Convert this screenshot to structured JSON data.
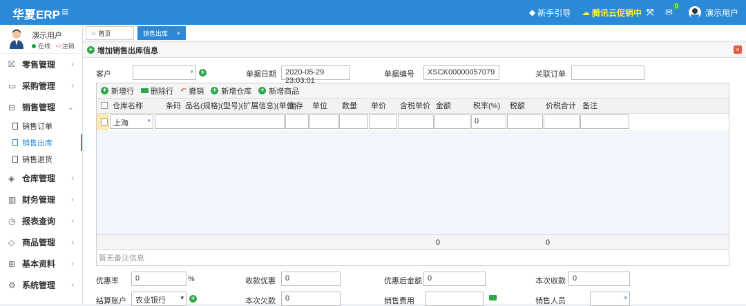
{
  "app": {
    "logo": "华夏ERP",
    "hamburger": "≡"
  },
  "topbar": {
    "guide": "新手引导",
    "promo": "腾讯云促销中",
    "mail_badge": "0",
    "user": "演示用户"
  },
  "user": {
    "name": "演示用户",
    "online": "在线",
    "logout": "注销"
  },
  "menu": [
    {
      "label": "零售管理",
      "icon": "gift-icon"
    },
    {
      "label": "采购管理",
      "icon": "monitor-icon"
    },
    {
      "label": "销售管理",
      "icon": "briefcase-icon"
    },
    {
      "label": "仓库管理",
      "icon": "layers-icon"
    },
    {
      "label": "财务管理",
      "icon": "columns-icon"
    },
    {
      "label": "报表查询",
      "icon": "clock-icon"
    },
    {
      "label": "商品管理",
      "icon": "gem-icon"
    },
    {
      "label": "基本资料",
      "icon": "grid-icon"
    },
    {
      "label": "系统管理",
      "icon": "gear-icon"
    }
  ],
  "submenu": [
    "销售订单",
    "销售出库",
    "销售退货"
  ],
  "tabs": {
    "home": "首页",
    "current": "销售出库",
    "close": "×"
  },
  "panel": {
    "title": "增加销售出库信息"
  },
  "form": {
    "customer_label": "客户",
    "date_label": "单据日期",
    "date_value": "2020-05-29 23:03:01",
    "number_label": "单据编号",
    "number_value": "XSCK00000057079",
    "order_label": "关联订单"
  },
  "toolbar": {
    "add_row": "新增行",
    "del_row": "删除行",
    "undo": "撤销",
    "add_depot": "新增仓库",
    "add_goods": "新增商品"
  },
  "columns": [
    "仓库名称",
    "条码",
    "品名(规格)(型号)(扩展信息)(单位)",
    "库存",
    "单位",
    "数量",
    "单价",
    "含税单价",
    "金额",
    "税率(%)",
    "税额",
    "价税合计",
    "备注"
  ],
  "row": {
    "depot": "上海",
    "tax_rate": "0"
  },
  "footer": {
    "amount": "0",
    "total": "0"
  },
  "note": {
    "placeholder": "暂无备注信息"
  },
  "bottom": {
    "discount_label": "优惠率",
    "discount_value": "0",
    "percent": "%",
    "discount_money_label": "收款优惠",
    "discount_money_value": "0",
    "after_label": "优惠后金额",
    "after_value": "0",
    "receive_label": "本次收款",
    "receive_value": "0",
    "account_label": "结算账户",
    "account_value": "农业银行",
    "debt_label": "本次欠款",
    "debt_value": "0",
    "fee_label": "销售费用",
    "seller_label": "销售人员"
  }
}
